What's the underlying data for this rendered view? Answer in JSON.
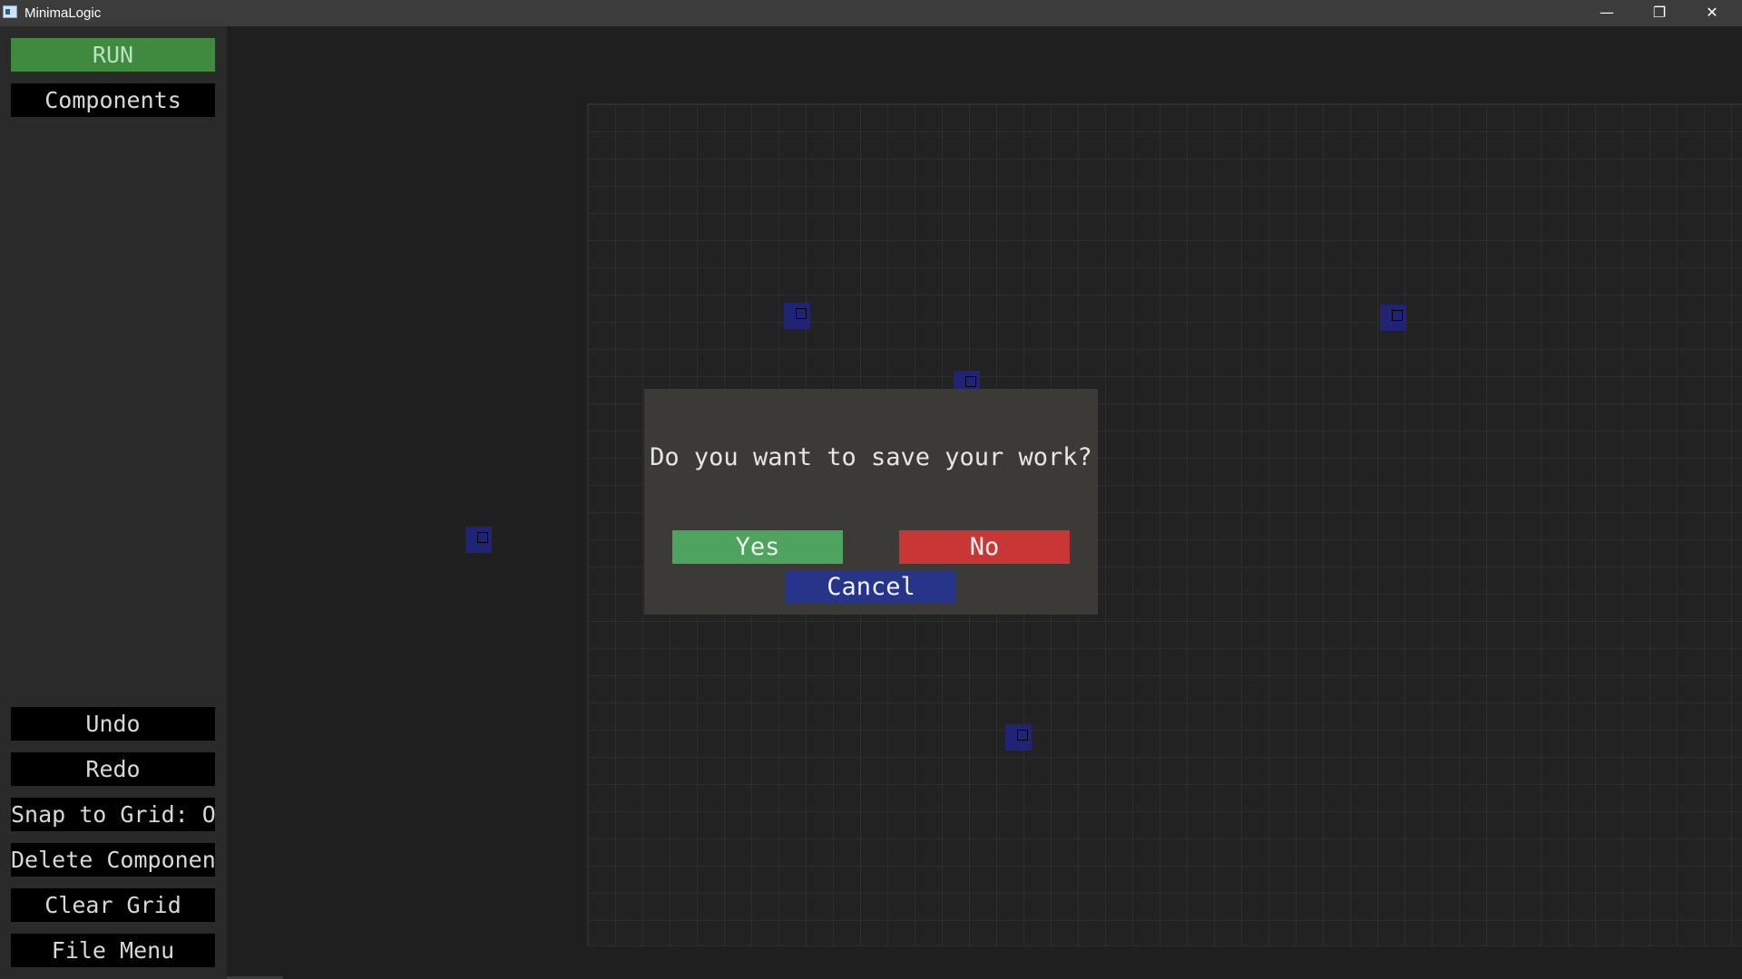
{
  "window": {
    "title": "MinimaLogic",
    "minimize_glyph": "—",
    "maximize_glyph": "❐",
    "close_glyph": "✕"
  },
  "sidebar": {
    "run_label": "RUN",
    "components_label": "Components",
    "undo_label": "Undo",
    "redo_label": "Redo",
    "snap_label": "Snap to Grid: Off",
    "delete_label": "Delete Component",
    "clear_label": "Clear Grid",
    "file_menu_label": "File Menu"
  },
  "dialog": {
    "message": "Do you want to save your work?",
    "yes_label": "Yes",
    "no_label": "No",
    "cancel_label": "Cancel"
  },
  "colors": {
    "run_green": "#3f8a3f",
    "yes_green": "#4ea35e",
    "no_red": "#c83636",
    "cancel_blue": "#26348a",
    "component_blue": "#202475",
    "dialog_bg": "#3c3a36"
  },
  "icons": {
    "app": "app-icon",
    "minimize": "minimize-icon",
    "maximize": "restore-icon",
    "close": "close-icon"
  }
}
